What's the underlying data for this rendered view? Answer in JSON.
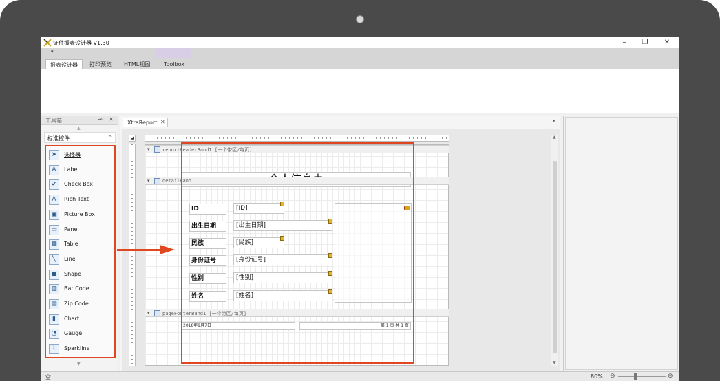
{
  "window": {
    "title": "证件报表设计器 V1.30",
    "minimize": "–",
    "restore": "❐",
    "close": "✕"
  },
  "ribbon": {
    "qat_arrow": "▾",
    "tabs": [
      {
        "label": "报表设计器",
        "active": true
      },
      {
        "label": "打印预览"
      },
      {
        "label": "HTML视图"
      },
      {
        "label": "Toolbox"
      }
    ]
  },
  "toolbox": {
    "title": "工具箱",
    "pin": "⊸",
    "close": "✕",
    "group": "标准控件",
    "group_chevron": "⌃",
    "scroll_up": "▲",
    "scroll_down": "▼",
    "items": [
      {
        "label": "选择器",
        "icon": "pointer-icon",
        "glyph": "➤",
        "selected": true
      },
      {
        "label": "Label",
        "icon": "label-icon",
        "glyph": "A"
      },
      {
        "label": "Check Box",
        "icon": "check-box-icon",
        "glyph": "✔"
      },
      {
        "label": "Rich Text",
        "icon": "rich-text-icon",
        "glyph": "A"
      },
      {
        "label": "Picture Box",
        "icon": "picture-box-icon",
        "glyph": "▣"
      },
      {
        "label": "Panel",
        "icon": "panel-icon",
        "glyph": "▭"
      },
      {
        "label": "Table",
        "icon": "table-icon",
        "glyph": "▦"
      },
      {
        "label": "Line",
        "icon": "line-icon",
        "glyph": "╲"
      },
      {
        "label": "Shape",
        "icon": "shape-icon",
        "glyph": "●"
      },
      {
        "label": "Bar Code",
        "icon": "bar-code-icon",
        "glyph": "▥"
      },
      {
        "label": "Zip Code",
        "icon": "zip-code-icon",
        "glyph": "▤"
      },
      {
        "label": "Chart",
        "icon": "chart-icon",
        "glyph": "▮"
      },
      {
        "label": "Gauge",
        "icon": "gauge-icon",
        "glyph": "◔"
      },
      {
        "label": "Sparkline",
        "icon": "sparkline-icon",
        "glyph": "⌇"
      }
    ]
  },
  "document": {
    "tab": "XtraReport",
    "tab_close": "✕",
    "menu_arrow": "▾",
    "corner": "◢",
    "bands": {
      "header": "reportHeaderBand1 [一个带区/每页]",
      "detail": "detailBand1",
      "footer": "pageFooterBand1 [一个带区/每页]",
      "arrow": "▾"
    },
    "report_title": "个人信息表",
    "fields": [
      {
        "label": "ID",
        "value": "[ID]"
      },
      {
        "label": "出生日期",
        "value": "[出生日期]"
      },
      {
        "label": "民族",
        "value": "[民族]"
      },
      {
        "label": "身份证号",
        "value": "[身份证号]"
      },
      {
        "label": "性别",
        "value": "[性别]"
      },
      {
        "label": "姓名",
        "value": "[姓名]"
      }
    ],
    "footer_date": "2018年9月7日",
    "footer_page": "第 1 页 共 1 页"
  },
  "statusbar": {
    "text": "空",
    "zoom": "80%",
    "zoom_minus": "⊖",
    "zoom_plus": "⊕",
    "zoom_level": 0.35
  },
  "colors": {
    "highlight": "#e0461f",
    "bezel": "#4a4a4a"
  }
}
